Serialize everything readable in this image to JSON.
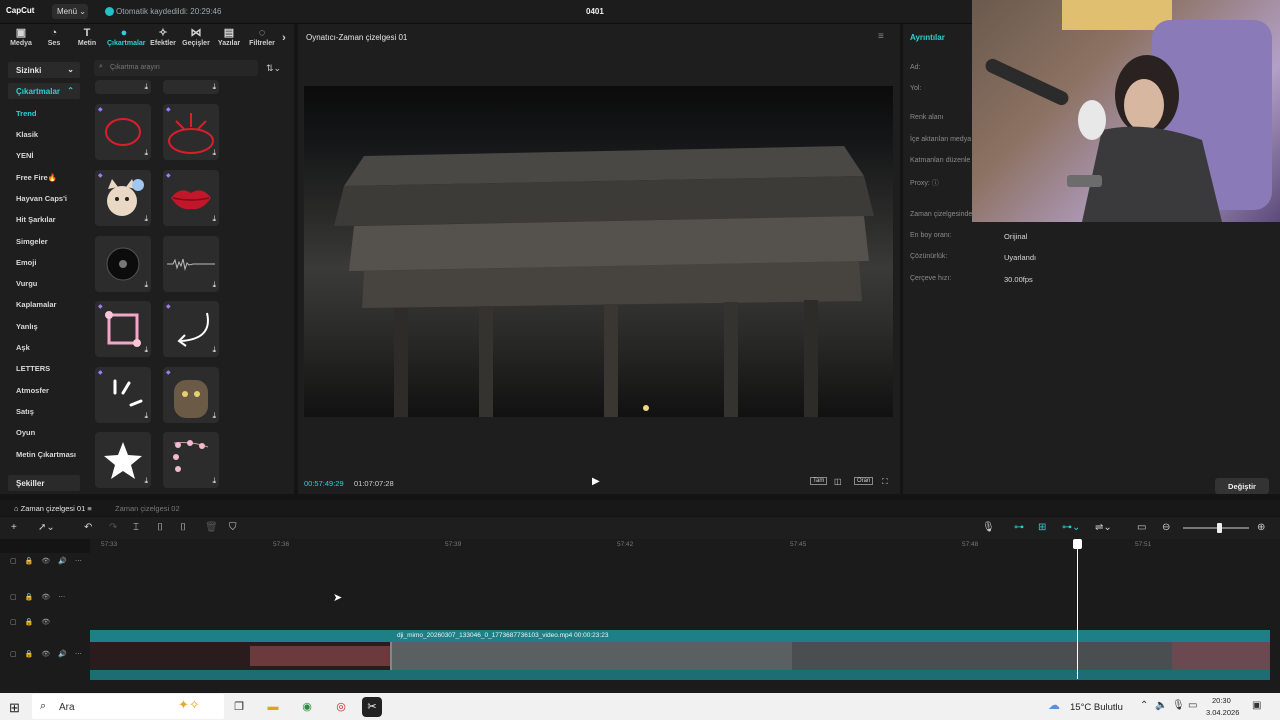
{
  "app": {
    "logo": "CapCut",
    "menu_label": "Menü",
    "autosave": "Otomatik kaydedildi: 20:29:46",
    "project_name": "0401"
  },
  "toolbar": {
    "items": [
      {
        "label": "Medya",
        "icon": "media-icon"
      },
      {
        "label": "Ses",
        "icon": "audio-icon"
      },
      {
        "label": "Metin",
        "icon": "text-icon"
      },
      {
        "label": "Çıkartmalar",
        "icon": "sticker-icon",
        "active": true
      },
      {
        "label": "Efektler",
        "icon": "effects-icon"
      },
      {
        "label": "Geçişler",
        "icon": "transitions-icon"
      },
      {
        "label": "Yazılar",
        "icon": "captions-icon"
      },
      {
        "label": "Filtreler",
        "icon": "filters-icon"
      }
    ]
  },
  "sidebar": {
    "section1": "Sizinki",
    "section2": "Çıkartmalar",
    "categories": [
      "Trend",
      "Klasik",
      "YENİ",
      "Free Fire🔥",
      "Hayvan Caps'i",
      "Hit Şarkılar",
      "Simgeler",
      "Emoji",
      "Vurgu",
      "Kaplamalar",
      "Yanlış",
      "Aşk",
      "LETTERS",
      "Atmosfer",
      "Satış",
      "Oyun",
      "Metin Çıkartması"
    ],
    "bottom": "Şekiller"
  },
  "search": {
    "placeholder": "Çıkartma arayın"
  },
  "player": {
    "title": "Oynatıcı-Zaman çizelgesi 01",
    "time_current": "00:57:49:29",
    "time_total": "01:07:07:28",
    "controls": [
      "Tam",
      "Oran"
    ]
  },
  "details": {
    "title": "Ayrıntılar",
    "labels": [
      "Ad:",
      "Yol:",
      "Renk alanı",
      "İçe aktarılan medya",
      "Katmanları düzenle",
      "Proxy:",
      "Zaman çizelgesinde",
      "En boy oranı:",
      "Çözünürlük:",
      "Çerçeve hızı:"
    ],
    "values": {
      "aspect": "Orijinal",
      "resolution": "Uyarlandı",
      "fps": "30.00fps"
    },
    "change_button": "Değiştir"
  },
  "timeline": {
    "tab1": "Zaman çizelgesi 01",
    "tab2": "Zaman çizelgesi 02",
    "ticks": [
      "57:33",
      "57:36",
      "57:39",
      "57:42",
      "57:45",
      "57:48",
      "57:51"
    ],
    "clip_label": "dji_mimo_20260307_133046_0_1773687736103_video.mp4   00:00:23:23",
    "zoom_level": 0.55
  },
  "taskbar": {
    "search_text": "Ara",
    "weather": "15°C  Bulutlu",
    "time": "20:30",
    "date": "3.04.2026"
  },
  "colors": {
    "accent": "#2fd0d4",
    "clip": "#1f7f86",
    "panel": "#1e1e1e"
  }
}
